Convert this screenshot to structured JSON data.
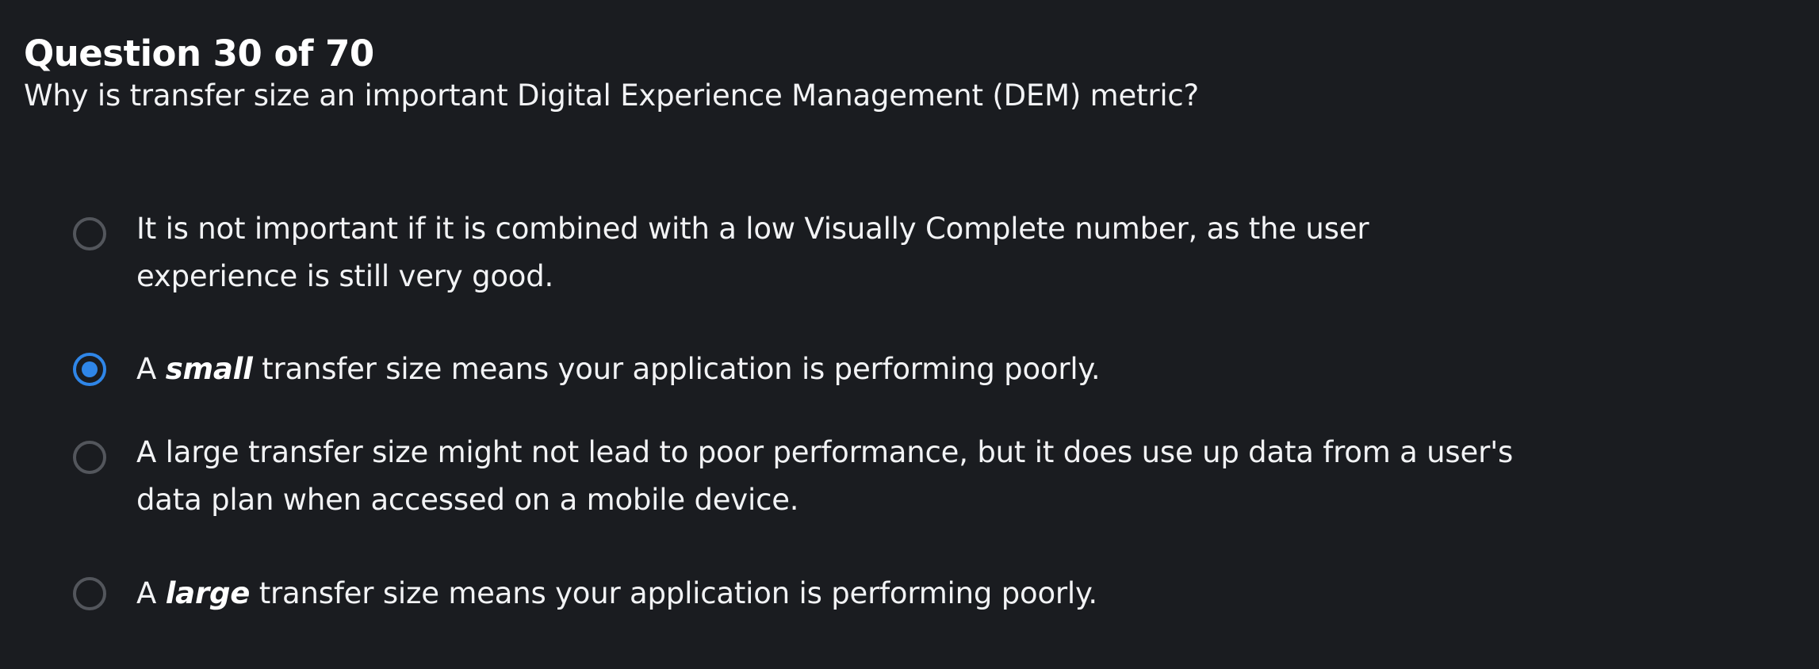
{
  "question": {
    "header": "Question 30 of 70",
    "text": "Why is transfer size an important Digital Experience Management (DEM) metric?"
  },
  "options": [
    {
      "line1": "It is not important if it is combined with a low Visually Complete number, as the user",
      "line2": "experience is still very good.",
      "selected": false
    },
    {
      "prefix": "A ",
      "emphasis": "small",
      "suffix": " transfer size means your application is performing poorly.",
      "selected": true
    },
    {
      "line1": "A large transfer size might not lead to poor performance, but it does use up data from a user's",
      "line2": "data plan when accessed on a mobile device.",
      "selected": false
    },
    {
      "prefix": "A ",
      "emphasis": "large",
      "suffix": " transfer size means your application is performing poorly.",
      "selected": false
    }
  ],
  "colors": {
    "background": "#1a1c20",
    "text": "#f2f3f5",
    "radio_border": "#53565c",
    "radio_selected": "#2f86e8"
  }
}
